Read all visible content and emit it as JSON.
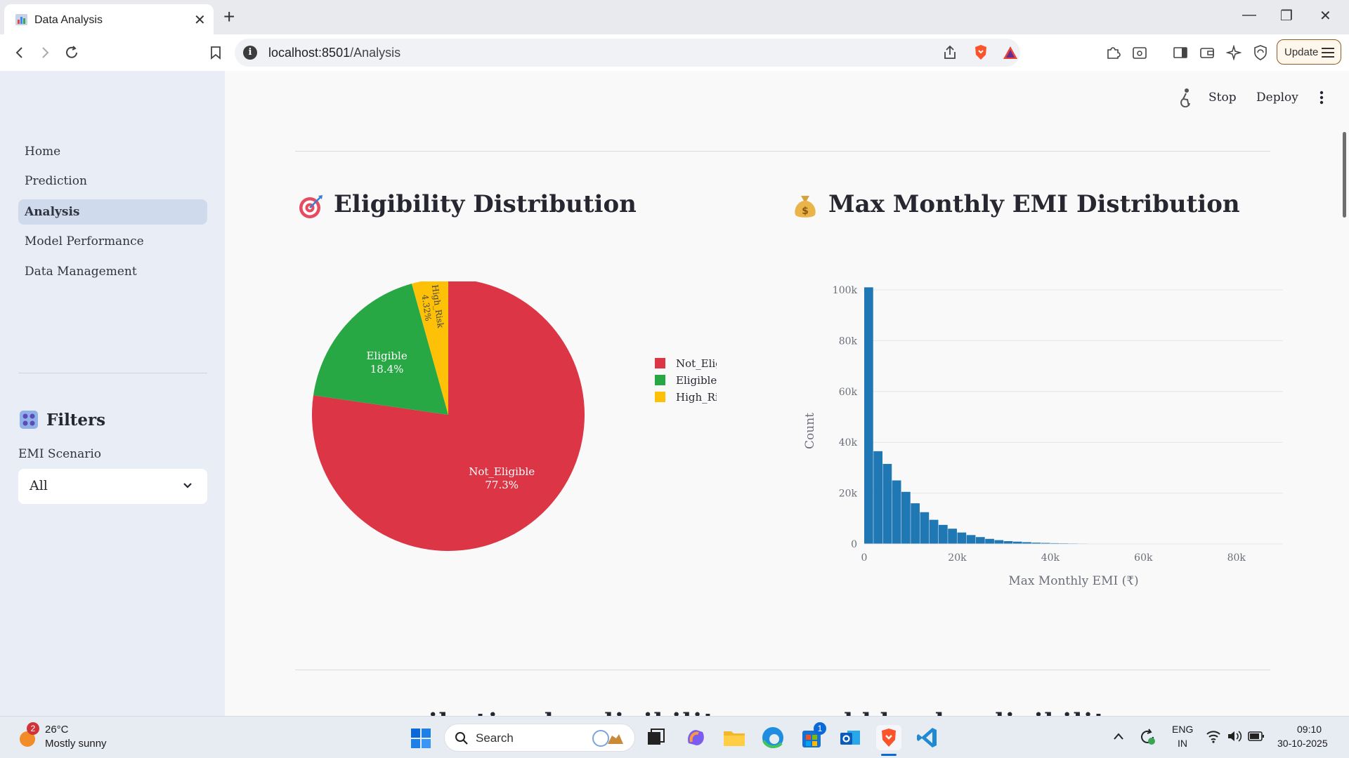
{
  "browser": {
    "tab_title": "Data Analysis",
    "url_host": "localhost:8501",
    "url_path": "/Analysis",
    "update_label": "Update"
  },
  "app": {
    "stop_label": "Stop",
    "deploy_label": "Deploy"
  },
  "sidebar": {
    "nav": [
      {
        "label": "Home",
        "active": false
      },
      {
        "label": "Prediction",
        "active": false
      },
      {
        "label": "Analysis",
        "active": true
      },
      {
        "label": "Model Performance",
        "active": false
      },
      {
        "label": "Data Management",
        "active": false
      }
    ],
    "filters_title": "Filters",
    "emi_label": "EMI Scenario",
    "emi_value": "All"
  },
  "main": {
    "eligibility_title": "Eligibility Distribution",
    "emi_title": "Max Monthly EMI Distribution",
    "next_section_fragment": "… ibution by eligibility … … …ddd … by eligibility"
  },
  "chart_data": [
    {
      "type": "pie",
      "labels": [
        "Not_Eligible",
        "Eligible",
        "High_Risk"
      ],
      "values": [
        77.3,
        18.4,
        4.32
      ],
      "value_labels": [
        "77.3%",
        "18.4%",
        "4.32%"
      ],
      "colors": [
        "#dc3545",
        "#28a745",
        "#ffc107"
      ],
      "legend": [
        "Not_Eligible",
        "Eligible",
        "High_Risk"
      ],
      "legend_position": "top-right"
    },
    {
      "type": "bar",
      "subtype": "histogram",
      "xlabel": "Max Monthly EMI (₹)",
      "ylabel": "Count",
      "xlim": [
        0,
        90000
      ],
      "ylim": [
        0,
        100000
      ],
      "xticks": [
        "0",
        "20k",
        "40k",
        "60k",
        "80k"
      ],
      "yticks": [
        "0",
        "20k",
        "40k",
        "60k",
        "80k",
        "100k"
      ],
      "bin_width": 2000,
      "bin_start": 0,
      "counts": [
        101000,
        36500,
        31500,
        25000,
        20500,
        16000,
        12500,
        9500,
        7500,
        6000,
        4500,
        3500,
        2700,
        2000,
        1500,
        1100,
        900,
        700,
        500,
        400,
        300,
        250,
        200,
        160,
        130,
        110,
        90,
        80,
        70,
        60,
        50,
        45,
        40,
        35,
        30,
        28,
        25,
        22,
        20,
        0,
        18,
        0,
        0,
        0,
        0
      ],
      "color": "#1f77b4",
      "grid": true
    }
  ],
  "taskbar": {
    "weather_temp": "26°C",
    "weather_desc": "Mostly sunny",
    "weather_badge": "2",
    "search_placeholder": "Search",
    "store_badge": "1",
    "lang_top": "ENG",
    "lang_bottom": "IN",
    "time": "09:10",
    "date": "30-10-2025"
  }
}
